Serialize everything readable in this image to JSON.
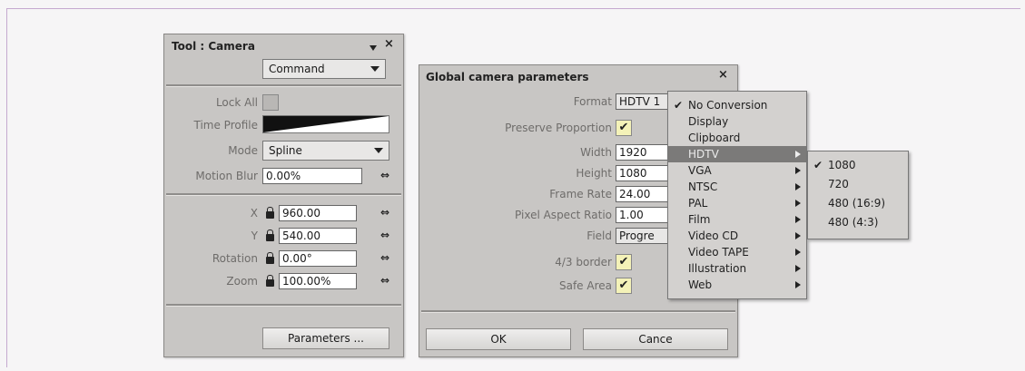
{
  "tool_panel": {
    "title": "Tool : Camera",
    "pin_icon": "pin-arrow-icon",
    "close_label": "×",
    "command_combo": "Command",
    "lock_all_label": "Lock All",
    "time_profile_label": "Time Profile",
    "mode_label": "Mode",
    "mode_value": "Spline",
    "motion_blur_label": "Motion Blur",
    "motion_blur_value": "0.00%",
    "x_label": "X",
    "x_value": "960.00",
    "y_label": "Y",
    "y_value": "540.00",
    "rotation_label": "Rotation",
    "rotation_value": "0.00°",
    "zoom_label": "Zoom",
    "zoom_value": "100.00%",
    "parameters_button": "Parameters ..."
  },
  "global_panel": {
    "title": "Global camera parameters",
    "close_label": "×",
    "format_label": "Format",
    "format_value": "HDTV 1",
    "preserve_label": "Preserve Proportion",
    "width_label": "Width",
    "width_value": "1920",
    "height_label": "Height",
    "height_value": "1080",
    "frame_rate_label": "Frame Rate",
    "frame_rate_value": "24.00",
    "pixel_aspect_label": "Pixel Aspect Ratio",
    "pixel_aspect_value": "1.00",
    "field_label": "Field",
    "field_value": "Progre",
    "border_label": "4/3 border",
    "safe_area_label": "Safe Area",
    "check_glyph": "✔",
    "ok_button": "OK",
    "cancel_button": "Cance"
  },
  "format_menu": {
    "items": [
      {
        "label": "No Conversion",
        "checked": "✔"
      },
      {
        "label": "Display"
      },
      {
        "label": "Clipboard"
      },
      {
        "label": "HDTV"
      },
      {
        "label": "VGA"
      },
      {
        "label": "NTSC"
      },
      {
        "label": "PAL"
      },
      {
        "label": "Film"
      },
      {
        "label": "Video CD"
      },
      {
        "label": "Video TAPE"
      },
      {
        "label": "Illustration"
      },
      {
        "label": "Web"
      }
    ]
  },
  "hdtv_submenu": {
    "items": [
      {
        "label": "1080",
        "checked": "✔"
      },
      {
        "label": "720"
      },
      {
        "label": "480 (16:9)"
      },
      {
        "label": "480 (4:3)"
      }
    ]
  },
  "colors": {
    "panel_bg": "#c8c6c4",
    "menu_highlight": "#7b7a79",
    "checkbox_fill": "#f4f2b8",
    "frame_border": "#c5a9cf"
  }
}
